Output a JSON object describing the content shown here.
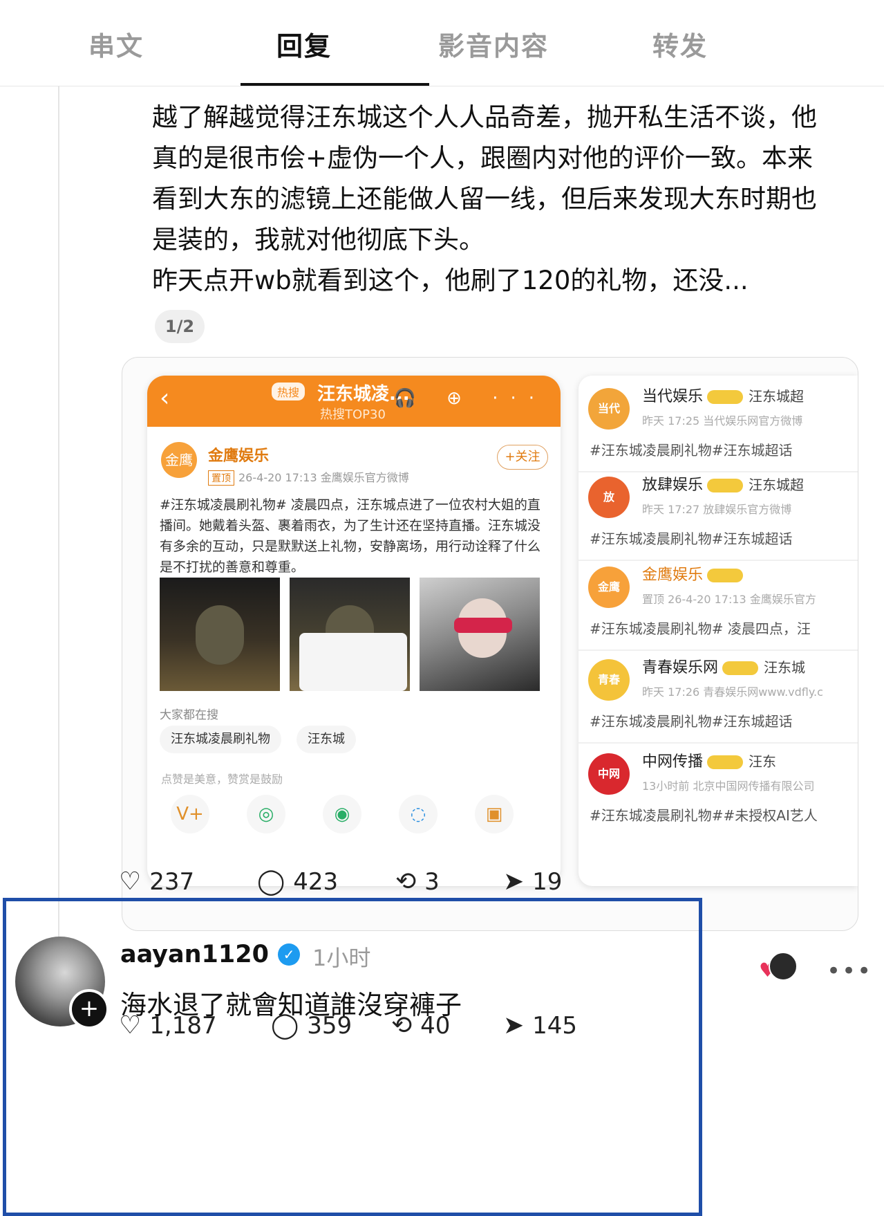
{
  "tabs": [
    "串文",
    "回复",
    "影音内容",
    "转发"
  ],
  "post": {
    "paragraphs": [
      "越了解越觉得汪东城这个人人品奇差，抛开私生活不谈，他真的是很市侩+虚伪一个人，跟圈内对他的评价一致。本来看到大东的滤镜上还能做人留一线，但后来发现大东时期也是装的，我就对他彻底下头。",
      "昨天点开wb就看到这个，他刷了120的礼物，还没..."
    ],
    "page_indicator": "1/2",
    "stats": {
      "likes": "237",
      "comments": "423",
      "reposts": "3",
      "shares": "19"
    }
  },
  "weibo_left": {
    "back": "‹",
    "hot_tag": "热搜",
    "hot_title": "汪东城凌...",
    "hot_sub": "热搜TOP30",
    "icons": "🎧 ⊕ ···",
    "account": "金鹰娱乐",
    "avatar_text": "金鹰",
    "top_tag": "置顶",
    "meta": "26-4-20 17:13 金鹰娱乐官方微博",
    "follow": "+关注",
    "body": "#汪东城凌晨刷礼物# 凌晨四点，汪东城点进了一位农村大姐的直播间。她戴着头盔、裹着雨衣，为了生计还在坚持直播。汪东城没有多余的互动，只是默默送上礼物，安静离场，用行动诠释了什么是不打扰的善意和尊重。",
    "search_label": "大家都在搜",
    "chips": [
      "汪东城凌晨刷礼物",
      "汪东城"
    ],
    "like_note": "点赞是美意，赞赏是鼓励",
    "share_icons": [
      "V+",
      "◎",
      "◉",
      "◌",
      "▣"
    ]
  },
  "weibo_right": [
    {
      "name": "当代娱乐",
      "extra": "汪东城超",
      "meta": "昨天 17:25 当代娱乐网官方微博",
      "tag": "#汪东城凌晨刷礼物#汪东城超话",
      "avatar_text": "当代",
      "color": "#f2a53a"
    },
    {
      "name": "放肆娱乐",
      "extra": "汪东城超",
      "meta": "昨天 17:27 放肆娱乐官方微博",
      "tag": "#汪东城凌晨刷礼物#汪东城超话",
      "avatar_text": "放",
      "color": "#e9632e"
    },
    {
      "name": "金鹰娱乐",
      "extra": "",
      "meta": "置顶 26-4-20 17:13 金鹰娱乐官方",
      "tag": "#汪东城凌晨刷礼物# 凌晨四点，汪",
      "avatar_text": "金鹰",
      "color": "#f7a13a"
    },
    {
      "name": "青春娱乐网",
      "extra": "汪东城",
      "meta": "昨天 17:26 青春娱乐网www.vdfly.c",
      "tag": "#汪东城凌晨刷礼物#汪东城超话",
      "avatar_text": "青春",
      "color": "#f4c33a"
    },
    {
      "name": "中网传播",
      "extra": "汪东",
      "meta": "13小时前 北京中国网传播有限公司",
      "tag": "#汪东城凌晨刷礼物##未授权AI艺人",
      "avatar_text": "中网",
      "color": "#d9282e"
    }
  ],
  "reply": {
    "username": "aayan1120",
    "time": "1小时",
    "text": "海水退了就會知道誰沒穿褲子",
    "stats": {
      "likes": "1,187",
      "comments": "359",
      "reposts": "40",
      "shares": "145"
    }
  },
  "colors": {
    "accent": "#f58a1f",
    "frame": "#1f4ea8",
    "verified": "#1d9bf0"
  }
}
